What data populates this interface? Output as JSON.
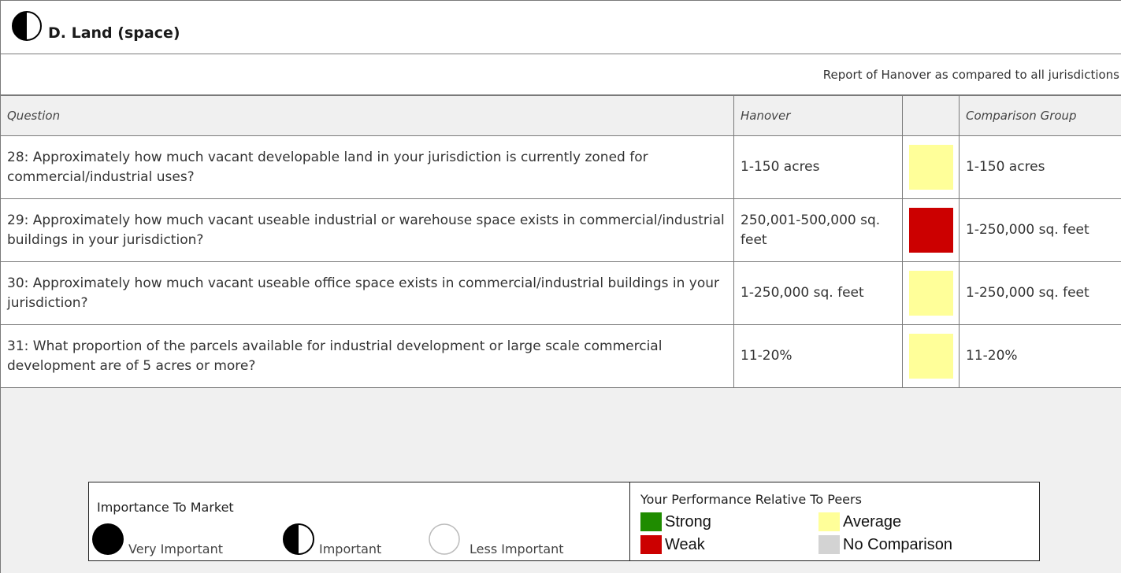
{
  "section": {
    "title": "D. Land (space)",
    "importance_icon": "half-circle-icon"
  },
  "report": {
    "caption": "Report of Hanover as compared to all jurisdictions"
  },
  "table": {
    "headers": {
      "question": "Question",
      "hanover": "Hanover",
      "indicator": "",
      "comparison": "Comparison Group"
    },
    "rows": [
      {
        "question": "28: Approximately how much vacant developable land in your jurisdiction is currently zoned for commercial/industrial uses?",
        "hanover": "1-150 acres",
        "performance": "Average",
        "color": "#ffff99",
        "comparison": "1-150 acres"
      },
      {
        "question": "29: Approximately how much vacant useable industrial or warehouse space exists in commercial/industrial buildings in your jurisdiction?",
        "hanover": "250,001-500,000 sq. feet",
        "performance": "Weak",
        "color": "#cc0000",
        "comparison": "1-250,000 sq. feet"
      },
      {
        "question": "30: Approximately how much vacant useable office space exists in commercial/industrial buildings in your jurisdiction?",
        "hanover": "1-250,000 sq. feet",
        "performance": "Average",
        "color": "#ffff99",
        "comparison": "1-250,000 sq. feet"
      },
      {
        "question": "31: What proportion of the parcels available for industrial development or large scale commercial development are of 5 acres or more?",
        "hanover": "11-20%",
        "performance": "Average",
        "color": "#ffff99",
        "comparison": "11-20%"
      }
    ]
  },
  "legend": {
    "importance": {
      "title": "Importance To Market",
      "items": [
        {
          "label": "Very Important",
          "icon": "full-circle-icon"
        },
        {
          "label": "Important",
          "icon": "half-circle-icon"
        },
        {
          "label": "Less Important",
          "icon": "empty-circle-icon"
        }
      ]
    },
    "performance": {
      "title": "Your Performance Relative To Peers",
      "items": [
        {
          "label": "Strong",
          "color": "#1f8c00"
        },
        {
          "label": "Average",
          "color": "#ffff99"
        },
        {
          "label": "Weak",
          "color": "#cc0000"
        },
        {
          "label": "No Comparison",
          "color": "#d3d3d3"
        }
      ]
    }
  }
}
